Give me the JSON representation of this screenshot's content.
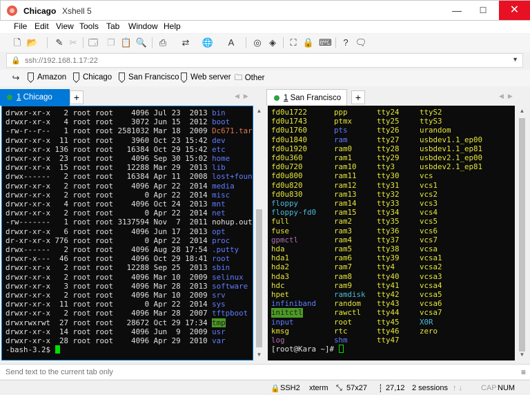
{
  "window": {
    "title_session": "Chicago",
    "title_app": "Xshell 5",
    "min": "—",
    "max": "☐",
    "close": "✕"
  },
  "menu": [
    "File",
    "Edit",
    "View",
    "Tools",
    "Tab",
    "Window",
    "Help"
  ],
  "address": {
    "value": "ssh://192.168.1.17:22",
    "placeholder": ""
  },
  "links": [
    "Amazon",
    "Chicago",
    "San Francisco",
    "Web server",
    "Other"
  ],
  "tabs": {
    "left": {
      "number": "1",
      "label": "Chicago",
      "add": "+"
    },
    "right": {
      "number": "1",
      "label": "San Francisco",
      "add": "+"
    },
    "arrows": "◀▶"
  },
  "left_terminal": {
    "rows": [
      {
        "p": "drwxr-xr-x",
        "n": "  2",
        "o": "root",
        "g": "root",
        "s": "   4096",
        "d": "Jul 23  2013",
        "f": "bin",
        "c": "c-blue"
      },
      {
        "p": "drwxr-xr-x",
        "n": "  4",
        "o": "root",
        "g": "root",
        "s": "   3072",
        "d": "Jun 15  2012",
        "f": "boot",
        "c": "c-blue"
      },
      {
        "p": "-rw-r--r--",
        "n": "  1",
        "o": "root",
        "g": "root",
        "s": "2581032",
        "d": "Mar 18  2009",
        "f": "Dc671.tar",
        "c": "c-red"
      },
      {
        "p": "drwxr-xr-x",
        "n": " 11",
        "o": "root",
        "g": "root",
        "s": "   3960",
        "d": "Oct 23 15:42",
        "f": "dev",
        "c": "c-blue"
      },
      {
        "p": "drwxr-xr-x",
        "n": "136",
        "o": "root",
        "g": "root",
        "s": "  16384",
        "d": "Oct 29 15:42",
        "f": "etc",
        "c": "c-blue"
      },
      {
        "p": "drwxr-xr-x",
        "n": " 23",
        "o": "root",
        "g": "root",
        "s": "   4096",
        "d": "Sep 30 15:02",
        "f": "home",
        "c": "c-blue"
      },
      {
        "p": "drwxr-xr-x",
        "n": " 15",
        "o": "root",
        "g": "root",
        "s": "  12288",
        "d": "Mar 29  2013",
        "f": "lib",
        "c": "c-blue"
      },
      {
        "p": "drwx------",
        "n": "  2",
        "o": "root",
        "g": "root",
        "s": "  16384",
        "d": "Apr 11  2008",
        "f": "lost+found",
        "c": "c-blue"
      },
      {
        "p": "drwxr-xr-x",
        "n": "  2",
        "o": "root",
        "g": "root",
        "s": "   4096",
        "d": "Apr 22  2014",
        "f": "media",
        "c": "c-blue"
      },
      {
        "p": "drwxr-xr-x",
        "n": "  2",
        "o": "root",
        "g": "root",
        "s": "      0",
        "d": "Apr 22  2014",
        "f": "misc",
        "c": "c-blue"
      },
      {
        "p": "drwxr-xr-x",
        "n": "  4",
        "o": "root",
        "g": "root",
        "s": "   4096",
        "d": "Oct 24  2013",
        "f": "mnt",
        "c": "c-blue"
      },
      {
        "p": "drwxr-xr-x",
        "n": "  2",
        "o": "root",
        "g": "root",
        "s": "      0",
        "d": "Apr 22  2014",
        "f": "net",
        "c": "c-blue"
      },
      {
        "p": "-rw-------",
        "n": "  1",
        "o": "root",
        "g": "root",
        "s": "3137594",
        "d": "Nov  7  2011",
        "f": "nohup.out",
        "c": ""
      },
      {
        "p": "drwxr-xr-x",
        "n": "  6",
        "o": "root",
        "g": "root",
        "s": "   4096",
        "d": "Jun 17  2013",
        "f": "opt",
        "c": "c-blue"
      },
      {
        "p": "dr-xr-xr-x",
        "n": "776",
        "o": "root",
        "g": "root",
        "s": "      0",
        "d": "Apr 22  2014",
        "f": "proc",
        "c": "c-blue"
      },
      {
        "p": "drwx------",
        "n": "  2",
        "o": "root",
        "g": "root",
        "s": "   4096",
        "d": "Aug 28 17:54",
        "f": ".putty",
        "c": "c-blue"
      },
      {
        "p": "drwxr-x---",
        "n": " 46",
        "o": "root",
        "g": "root",
        "s": "   4096",
        "d": "Oct 29 18:41",
        "f": "root",
        "c": "c-blue"
      },
      {
        "p": "drwxr-xr-x",
        "n": "  2",
        "o": "root",
        "g": "root",
        "s": "  12288",
        "d": "Sep 25  2013",
        "f": "sbin",
        "c": "c-blue"
      },
      {
        "p": "drwxr-xr-x",
        "n": "  2",
        "o": "root",
        "g": "root",
        "s": "   4096",
        "d": "Mar 10  2009",
        "f": "selinux",
        "c": "c-blue"
      },
      {
        "p": "drwxr-xr-x",
        "n": "  3",
        "o": "root",
        "g": "root",
        "s": "   4096",
        "d": "Mar 28  2013",
        "f": "software",
        "c": "c-blue"
      },
      {
        "p": "drwxr-xr-x",
        "n": "  2",
        "o": "root",
        "g": "root",
        "s": "   4096",
        "d": "Mar 10  2009",
        "f": "srv",
        "c": "c-blue"
      },
      {
        "p": "drwxr-xr-x",
        "n": " 11",
        "o": "root",
        "g": "root",
        "s": "      0",
        "d": "Apr 22  2014",
        "f": "sys",
        "c": "c-blue"
      },
      {
        "p": "drwxr-xr-x",
        "n": "  2",
        "o": "root",
        "g": "root",
        "s": "   4096",
        "d": "Mar 28  2007",
        "f": "tftpboot",
        "c": "c-blue"
      },
      {
        "p": "drwxrwxrwt",
        "n": " 27",
        "o": "root",
        "g": "root",
        "s": "  28672",
        "d": "Oct 29 17:34",
        "f": "tmp",
        "c": "hl-green"
      },
      {
        "p": "drwxr-xr-x",
        "n": " 14",
        "o": "root",
        "g": "root",
        "s": "   4096",
        "d": "Jun  9  2009",
        "f": "usr",
        "c": "c-blue"
      },
      {
        "p": "drwxr-xr-x",
        "n": " 28",
        "o": "root",
        "g": "root",
        "s": "   4096",
        "d": "Apr 29  2010",
        "f": "var",
        "c": "c-blue"
      }
    ],
    "prompt": "-bash-3.2$ "
  },
  "right_terminal": {
    "columns": [
      [
        [
          "fd0u1722",
          "c-yellow"
        ],
        [
          "fd0u1743",
          "c-yellow"
        ],
        [
          "fd0u1760",
          "c-yellow"
        ],
        [
          "fd0u1840",
          "c-yellow"
        ],
        [
          "fd0u1920",
          "c-yellow"
        ],
        [
          "fd0u360",
          "c-yellow"
        ],
        [
          "fd0u720",
          "c-yellow"
        ],
        [
          "fd0u800",
          "c-yellow"
        ],
        [
          "fd0u820",
          "c-yellow"
        ],
        [
          "fd0u830",
          "c-yellow"
        ],
        [
          "floppy",
          "c-cyan"
        ],
        [
          "floppy-fd0",
          "c-cyan"
        ],
        [
          "full",
          "c-yellow"
        ],
        [
          "fuse",
          "c-yellow"
        ],
        [
          "gpmctl",
          "c-mag"
        ],
        [
          "hda",
          "c-yellow"
        ],
        [
          "hda1",
          "c-yellow"
        ],
        [
          "hda2",
          "c-yellow"
        ],
        [
          "hda3",
          "c-yellow"
        ],
        [
          "hdc",
          "c-yellow"
        ],
        [
          "hpet",
          "c-yellow"
        ],
        [
          "infiniband",
          "c-blue"
        ],
        [
          "initctl",
          "hl-green"
        ],
        [
          "input",
          "c-blue"
        ],
        [
          "kmsg",
          "c-yellow"
        ],
        [
          "log",
          "c-mag"
        ]
      ],
      [
        [
          "ppp",
          "c-yellow"
        ],
        [
          "ptmx",
          "c-yellow"
        ],
        [
          "pts",
          "c-blue"
        ],
        [
          "ram",
          "c-blue"
        ],
        [
          "ram0",
          "c-yellow"
        ],
        [
          "ram1",
          "c-yellow"
        ],
        [
          "ram10",
          "c-yellow"
        ],
        [
          "ram11",
          "c-yellow"
        ],
        [
          "ram12",
          "c-yellow"
        ],
        [
          "ram13",
          "c-yellow"
        ],
        [
          "ram14",
          "c-yellow"
        ],
        [
          "ram15",
          "c-yellow"
        ],
        [
          "ram2",
          "c-yellow"
        ],
        [
          "ram3",
          "c-yellow"
        ],
        [
          "ram4",
          "c-yellow"
        ],
        [
          "ram5",
          "c-yellow"
        ],
        [
          "ram6",
          "c-yellow"
        ],
        [
          "ram7",
          "c-yellow"
        ],
        [
          "ram8",
          "c-yellow"
        ],
        [
          "ram9",
          "c-yellow"
        ],
        [
          "ramdisk",
          "c-cyan"
        ],
        [
          "random",
          "c-yellow"
        ],
        [
          "rawctl",
          "c-yellow"
        ],
        [
          "root",
          "c-yellow"
        ],
        [
          "rtc",
          "c-yellow"
        ],
        [
          "shm",
          "c-blue"
        ]
      ],
      [
        [
          "tty24",
          "c-yellow"
        ],
        [
          "tty25",
          "c-yellow"
        ],
        [
          "tty26",
          "c-yellow"
        ],
        [
          "tty27",
          "c-yellow"
        ],
        [
          "tty28",
          "c-yellow"
        ],
        [
          "tty29",
          "c-yellow"
        ],
        [
          "tty3",
          "c-yellow"
        ],
        [
          "tty30",
          "c-yellow"
        ],
        [
          "tty31",
          "c-yellow"
        ],
        [
          "tty32",
          "c-yellow"
        ],
        [
          "tty33",
          "c-yellow"
        ],
        [
          "tty34",
          "c-yellow"
        ],
        [
          "tty35",
          "c-yellow"
        ],
        [
          "tty36",
          "c-yellow"
        ],
        [
          "tty37",
          "c-yellow"
        ],
        [
          "tty38",
          "c-yellow"
        ],
        [
          "tty39",
          "c-yellow"
        ],
        [
          "tty4",
          "c-yellow"
        ],
        [
          "tty40",
          "c-yellow"
        ],
        [
          "tty41",
          "c-yellow"
        ],
        [
          "tty42",
          "c-yellow"
        ],
        [
          "tty43",
          "c-yellow"
        ],
        [
          "tty44",
          "c-yellow"
        ],
        [
          "tty45",
          "c-yellow"
        ],
        [
          "tty46",
          "c-yellow"
        ],
        [
          "tty47",
          "c-yellow"
        ]
      ],
      [
        [
          "ttyS2",
          "c-yellow"
        ],
        [
          "ttyS3",
          "c-yellow"
        ],
        [
          "urandom",
          "c-yellow"
        ],
        [
          "usbdev1.1_ep00",
          "c-yellow"
        ],
        [
          "usbdev1.1_ep81",
          "c-yellow"
        ],
        [
          "usbdev2.1_ep00",
          "c-yellow"
        ],
        [
          "usbdev2.1_ep81",
          "c-yellow"
        ],
        [
          "vcs",
          "c-yellow"
        ],
        [
          "vcs1",
          "c-yellow"
        ],
        [
          "vcs2",
          "c-yellow"
        ],
        [
          "vcs3",
          "c-yellow"
        ],
        [
          "vcs4",
          "c-yellow"
        ],
        [
          "vcs5",
          "c-yellow"
        ],
        [
          "vcs6",
          "c-yellow"
        ],
        [
          "vcs7",
          "c-yellow"
        ],
        [
          "vcsa",
          "c-yellow"
        ],
        [
          "vcsa1",
          "c-yellow"
        ],
        [
          "vcsa2",
          "c-yellow"
        ],
        [
          "vcsa3",
          "c-yellow"
        ],
        [
          "vcsa4",
          "c-yellow"
        ],
        [
          "vcsa5",
          "c-yellow"
        ],
        [
          "vcsa6",
          "c-yellow"
        ],
        [
          "vcsa7",
          "c-yellow"
        ],
        [
          "X0R",
          "c-cyan"
        ],
        [
          "zero",
          "c-yellow"
        ]
      ]
    ],
    "prompt": "[root@Kara ~]# "
  },
  "sendbar": {
    "placeholder": "Send text to the current tab only",
    "menu": "≡"
  },
  "status": {
    "protocol": "SSH2",
    "terminal": "xterm",
    "size": "57x27",
    "cursor_pos": "27,12",
    "sessions": "2 sessions",
    "cap": "CAP",
    "num": "NUM",
    "arrows": "↑ ↓"
  },
  "colors": {
    "accent": "#0078d7",
    "close": "#e81123",
    "term_bg": "#0c0c0c",
    "cursor": "#00e000"
  },
  "icons": [
    "new-session-icon",
    "open-folder-icon",
    "properties-icon",
    "disconnect-icon",
    "new-transfer-icon",
    "copy-icon",
    "paste-icon",
    "find-icon",
    "print-icon",
    "transfer-icon",
    "globe-icon",
    "font-icon",
    "compose-icon",
    "xftp-icon",
    "fullscreen-icon",
    "lock-icon",
    "keyboard-icon",
    "help-icon",
    "chat-icon"
  ]
}
